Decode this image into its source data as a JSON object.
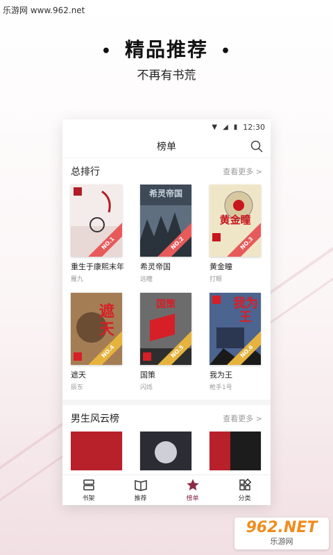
{
  "watermark": "乐游网 www.962.net",
  "promo": {
    "dot": "•",
    "title": "精品推荐",
    "subtitle": "不再有书荒"
  },
  "statusbar": {
    "wifi_icon": "wifi-icon",
    "signal_icon": "signal-icon",
    "battery_icon": "battery-icon",
    "time": "12:30"
  },
  "navbar": {
    "title": "榜单",
    "search_icon": "search-icon"
  },
  "sections": [
    {
      "title": "总排行",
      "more": "查看更多 >",
      "books": [
        {
          "title": "重生于康熙末年",
          "author": "雁九",
          "rank": "NO.1",
          "cover_text": "",
          "bg": "#f4ecea",
          "accent": "#b01d26"
        },
        {
          "title": "希灵帝国",
          "author": "远瞳",
          "rank": "NO.2",
          "cover_text": "希灵帝国",
          "bg": "#3e4a57",
          "accent": "#c7d2dd"
        },
        {
          "title": "黄金瞳",
          "author": "打眼",
          "rank": "NO.3",
          "cover_text": "黄金瞳",
          "bg": "#efe6c8",
          "accent": "#c8161d"
        },
        {
          "title": "遮天",
          "author": "辰东",
          "rank": "NO.4",
          "cover_text": "遮天",
          "bg": "#8a6a4a",
          "accent": "#d61f26"
        },
        {
          "title": "国策",
          "author": "闪烁",
          "rank": "NO.5",
          "cover_text": "国策",
          "bg": "#5a5a5a",
          "accent": "#d61f26"
        },
        {
          "title": "我为王",
          "author": "枪手1号",
          "rank": "NO.6",
          "cover_text": "我为王",
          "bg": "#3b4f73",
          "accent": "#d61f26"
        }
      ]
    },
    {
      "title": "男生风云榜",
      "more": "查看更多 >",
      "books": [
        {
          "bg": "#b8202a"
        },
        {
          "bg": "#2c2c34"
        },
        {
          "bg": "#1c1c1c"
        }
      ]
    }
  ],
  "tabs": [
    {
      "label": "书架",
      "icon": "bookshelf-icon",
      "active": false
    },
    {
      "label": "推荐",
      "icon": "book-icon",
      "active": false
    },
    {
      "label": "榜单",
      "icon": "star-icon",
      "active": true
    },
    {
      "label": "分类",
      "icon": "grid-icon",
      "active": false
    }
  ],
  "logo": {
    "big": "962.NET",
    "small": "乐游网"
  },
  "colors": {
    "accent": "#8b2c44",
    "rank_red": "#e85a5a",
    "rank_gold": "#e6b33d"
  }
}
